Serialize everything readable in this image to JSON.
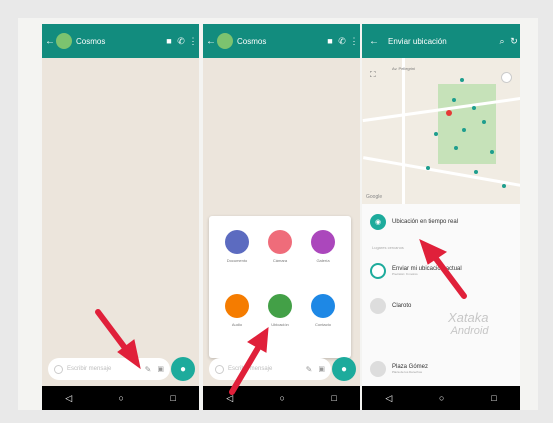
{
  "panels": [
    {
      "header": {
        "title": "Cosmos"
      },
      "input": {
        "placeholder": "Escribir mensaje"
      }
    },
    {
      "header": {
        "title": "Cosmos"
      },
      "attach": [
        {
          "label": "Documento",
          "color": "#5c6bc0"
        },
        {
          "label": "Cámara",
          "color": "#ef6c7a"
        },
        {
          "label": "Galería",
          "color": "#ab47bc"
        },
        {
          "label": "Audio",
          "color": "#f57c00"
        },
        {
          "label": "Ubicación",
          "color": "#43a047"
        },
        {
          "label": "Contacto",
          "color": "#1e88e5"
        }
      ],
      "input": {
        "placeholder": "Escribir mensaje"
      }
    },
    {
      "header": {
        "title": "Enviar ubicación"
      },
      "map": {
        "street_label": "Av. Pellegrini",
        "google": "Google"
      },
      "items": [
        {
          "label": "Ubicación en tiempo real",
          "sub": ""
        },
        {
          "label": "Enviar mi ubicación actual",
          "sub": "Precisión: 9 metros"
        },
        {
          "label": "Claroto",
          "sub": ""
        },
        {
          "label": "Plaza Gómez",
          "sub": "Plaza de los Derechos"
        }
      ],
      "section_label": "Lugares cercanos"
    }
  ],
  "watermark": {
    "line1": "Xataka",
    "line2": "Android"
  },
  "colors": {
    "header": "#128c7e",
    "accent": "#1dab9c",
    "arrow": "#e0203a"
  }
}
